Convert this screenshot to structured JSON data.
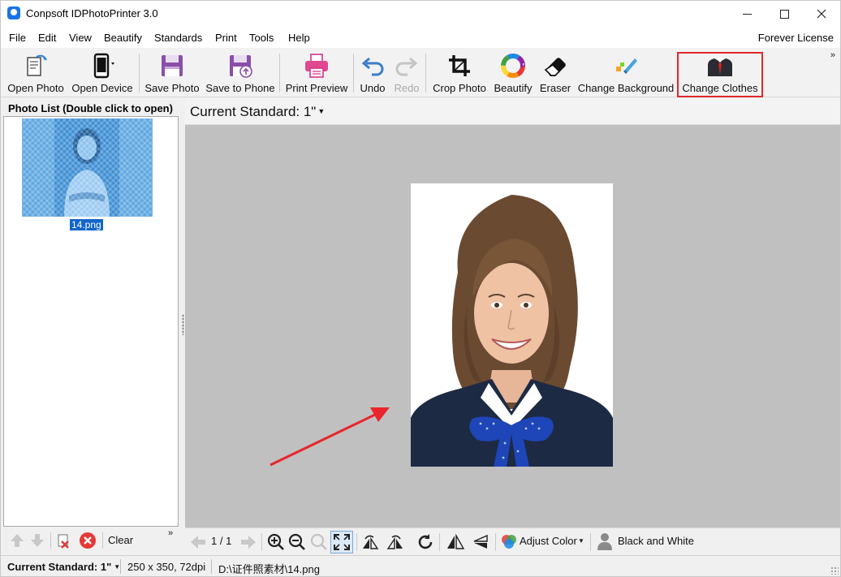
{
  "window": {
    "title": "Conpsoft IDPhotoPrinter 3.0"
  },
  "menu": {
    "items": [
      "File",
      "Edit",
      "View",
      "Beautify",
      "Standards",
      "Print",
      "Tools",
      "Help"
    ],
    "license": "Forever License"
  },
  "toolbar": {
    "buttons": [
      {
        "label": "Open Photo",
        "icon": "open-photo-icon"
      },
      {
        "label": "Open Device",
        "icon": "phone-icon"
      },
      {
        "label": "Save Photo",
        "icon": "floppy-icon"
      },
      {
        "label": "Save to Phone",
        "icon": "floppy-phone-icon"
      },
      {
        "label": "Print Preview",
        "icon": "printer-icon"
      },
      {
        "label": "Undo",
        "icon": "undo-icon"
      },
      {
        "label": "Redo",
        "icon": "redo-icon",
        "disabled": true
      },
      {
        "label": "Crop Photo",
        "icon": "crop-icon"
      },
      {
        "label": "Beautify",
        "icon": "color-wheel-icon"
      },
      {
        "label": "Eraser",
        "icon": "eraser-icon"
      },
      {
        "label": "Change Background",
        "icon": "paint-brush-icon"
      },
      {
        "label": "Change Clothes",
        "icon": "suit-icon",
        "highlighted": true
      }
    ]
  },
  "left_panel": {
    "title": "Photo List (Double click to open)",
    "photos": [
      {
        "name": "14.png"
      }
    ],
    "clear_label": "Clear"
  },
  "main": {
    "current_standard": "Current Standard: 1\"",
    "page_indicator": "1 / 1",
    "adjust_color_label": "Adjust Color",
    "black_white_label": "Black and White"
  },
  "statusbar": {
    "standard": "Current Standard: 1\"",
    "dimensions": "250 x 350, 72dpi",
    "path": "D:\\证件照素材\\14.png"
  },
  "colors": {
    "accent": "#1166cc",
    "highlight_border": "#e0262b",
    "canvas_bg": "#c0c0c0",
    "arrow": "#e8262b"
  }
}
